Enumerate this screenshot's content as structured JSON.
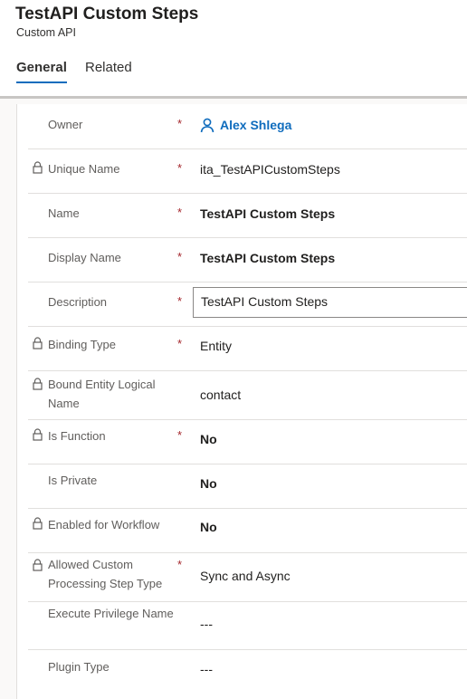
{
  "record": {
    "title": "TestAPI Custom Steps",
    "entity_type": "Custom API"
  },
  "tabs": [
    {
      "label": "General",
      "selected": true
    },
    {
      "label": "Related",
      "selected": false
    }
  ],
  "colors": {
    "accent": "#0f6cbd",
    "required": "#a4262c"
  },
  "fields": [
    {
      "label": "Owner",
      "required": true,
      "locked": false,
      "value": "Alex Shlega",
      "icon": "person-icon",
      "type": "lookup"
    },
    {
      "label": "Unique Name",
      "required": true,
      "locked": true,
      "value": "ita_TestAPICustomSteps"
    },
    {
      "label": "Name",
      "required": true,
      "locked": false,
      "value": "TestAPI Custom Steps"
    },
    {
      "label": "Display Name",
      "required": true,
      "locked": false,
      "value": "TestAPI Custom Steps"
    },
    {
      "label": "Description",
      "required": true,
      "locked": false,
      "value": "TestAPI Custom Steps",
      "type": "textbox"
    },
    {
      "label": "Binding Type",
      "required": true,
      "locked": true,
      "value": "Entity"
    },
    {
      "label": "Bound Entity Logical Name",
      "required": false,
      "locked": true,
      "value": "contact"
    },
    {
      "label": "Is Function",
      "required": true,
      "locked": true,
      "value": "No"
    },
    {
      "label": "Is Private",
      "required": false,
      "locked": false,
      "value": "No"
    },
    {
      "label": "Enabled for Workflow",
      "required": false,
      "locked": true,
      "value": "No"
    },
    {
      "label": "Allowed Custom Processing Step Type",
      "required": true,
      "locked": true,
      "value": "Sync and Async"
    },
    {
      "label": "Execute Privilege Name",
      "required": false,
      "locked": false,
      "value": "---"
    },
    {
      "label": "Plugin Type",
      "required": false,
      "locked": false,
      "value": "---"
    }
  ],
  "required_marker": "*"
}
